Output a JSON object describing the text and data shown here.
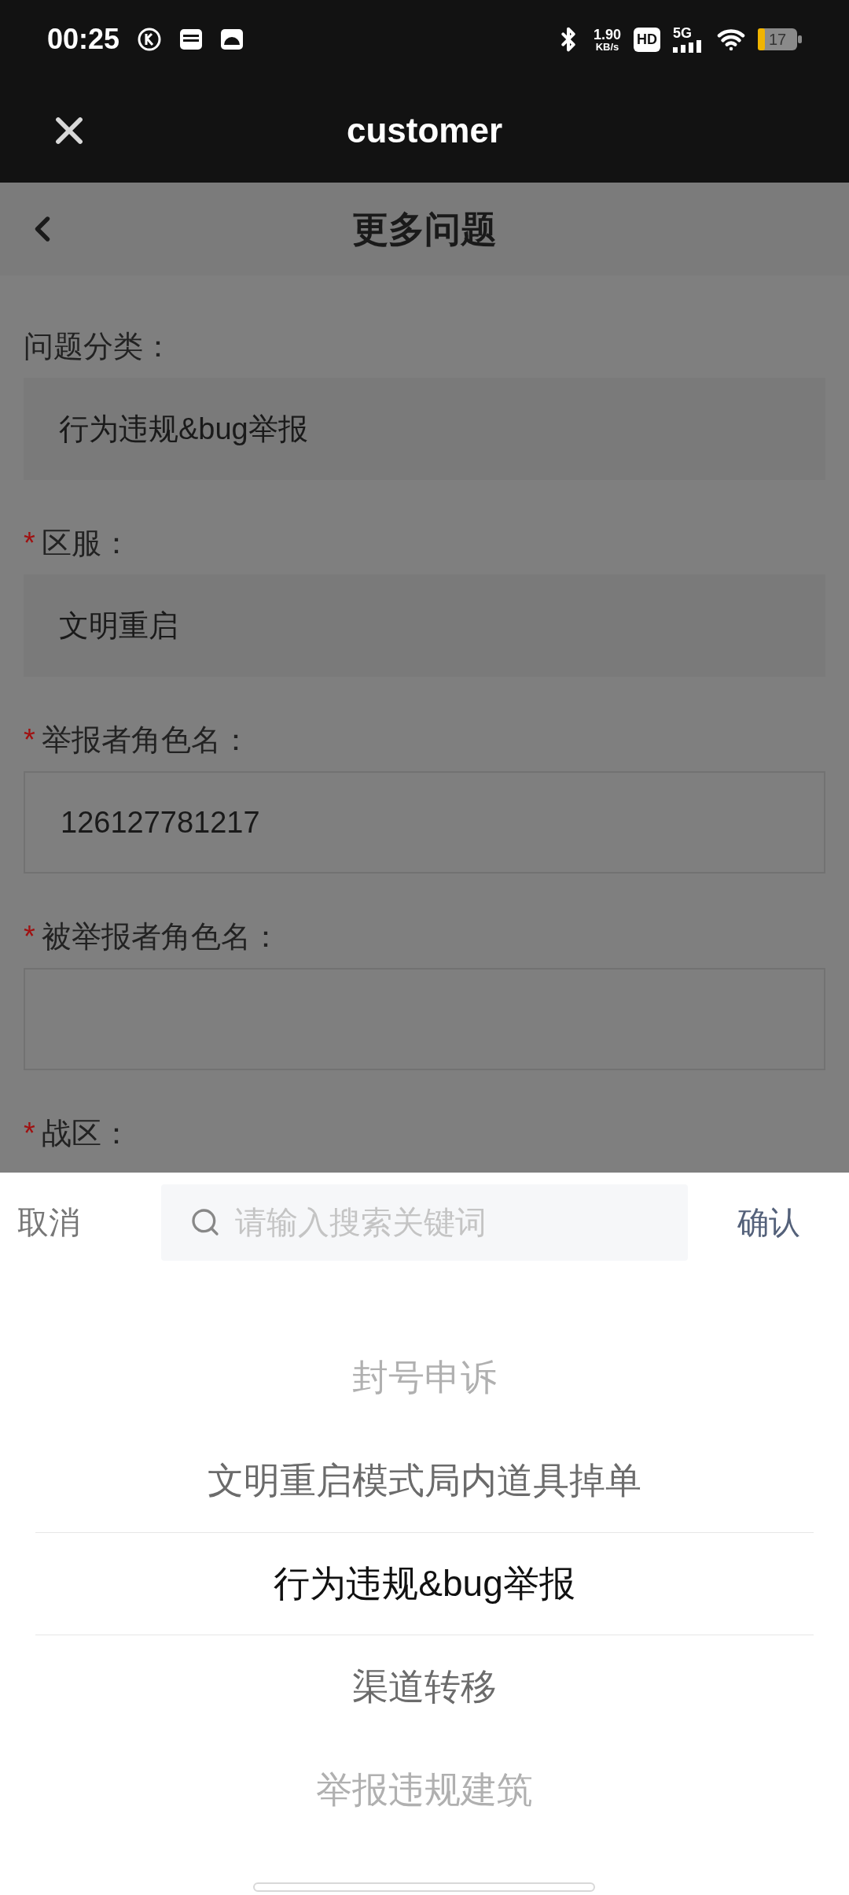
{
  "status_bar": {
    "time": "00:25",
    "speed": "1.90",
    "speed_unit": "KB/s",
    "hd": "HD",
    "network": "5G",
    "battery": "17"
  },
  "app_bar": {
    "title": "customer"
  },
  "page": {
    "title": "更多问题"
  },
  "form": {
    "fields": [
      {
        "label": "问题分类：",
        "kind": "select",
        "value": "行为违规&bug举报"
      },
      {
        "label": "区服：",
        "required_mark": "*",
        "kind": "select",
        "value": "文明重启"
      },
      {
        "label": "举报者角色名：",
        "required_mark": "*",
        "kind": "input",
        "value": "126127781217"
      },
      {
        "label": "被举报者角色名：",
        "required_mark": "*",
        "kind": "input"
      },
      {
        "label": "战区：",
        "required_mark": "*",
        "kind": "hidden"
      }
    ]
  },
  "picker": {
    "cancel": "取消",
    "confirm": "确认",
    "search": {
      "placeholder": "请输入搜索关键词"
    },
    "options": [
      {
        "label": "封号申诉",
        "selected": false
      },
      {
        "label": "文明重启模式局内道具掉单",
        "selected": false
      },
      {
        "label": "行为违规&bug举报",
        "selected": true
      },
      {
        "label": "渠道转移",
        "selected": false
      },
      {
        "label": "举报违规建筑",
        "selected": false
      }
    ]
  }
}
